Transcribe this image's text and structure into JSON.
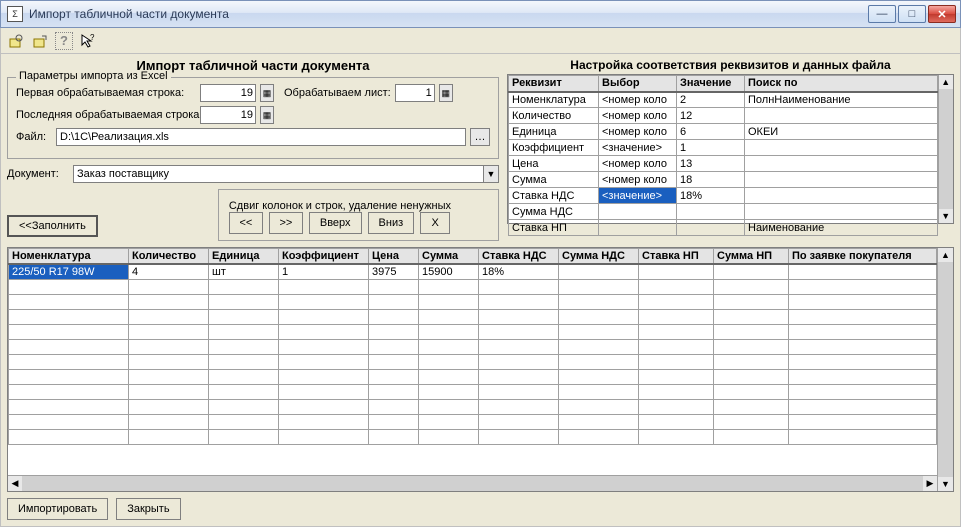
{
  "window": {
    "title": "Импорт табличной части документа"
  },
  "toolbar_icons": [
    "cfg1",
    "cfg2",
    "help",
    "cursor"
  ],
  "left": {
    "title": "Импорт табличной части документа",
    "group_legend": "Параметры импорта из Excel",
    "first_row_label": "Первая обрабатываемая строка:",
    "first_row_value": "19",
    "sheet_label": "Обрабатываем лист:",
    "sheet_value": "1",
    "last_row_label": "Последняя обрабатываемая строка:",
    "last_row_value": "19",
    "file_label": "Файл:",
    "file_value": "D:\\1C\\Реализация.xls",
    "doc_label": "Документ:",
    "doc_value": "Заказ поставщику",
    "shift_legend": "Сдвиг колонок и строк, удаление ненужных",
    "btn_fill": "<<Заполнить",
    "btn_left": "<<",
    "btn_right": ">>",
    "btn_up": "Вверх",
    "btn_down": "Вниз",
    "btn_del": "X"
  },
  "right": {
    "title": "Настройка соответствия реквизитов и данных файла",
    "headers": {
      "c0": "Реквизит",
      "c1": "Выбор",
      "c2": "Значение",
      "c3": "Поиск по"
    },
    "rows": [
      {
        "c0": "Номенклатура",
        "c1": "<номер коло",
        "c2": "2",
        "c3": "ПолнНаименование"
      },
      {
        "c0": "Количество",
        "c1": "<номер коло",
        "c2": "12",
        "c3": ""
      },
      {
        "c0": "Единица",
        "c1": "<номер коло",
        "c2": "6",
        "c3": "ОКЕИ"
      },
      {
        "c0": "Коэффициент",
        "c1": "<значение>",
        "c2": "1",
        "c3": ""
      },
      {
        "c0": "Цена",
        "c1": "<номер коло",
        "c2": "13",
        "c3": ""
      },
      {
        "c0": "Сумма",
        "c1": "<номер коло",
        "c2": "18",
        "c3": ""
      },
      {
        "c0": "Ставка НДС",
        "c1": "<значение>",
        "c2": "18%",
        "c3": "",
        "sel": true
      },
      {
        "c0": "Сумма НДС",
        "c1": "",
        "c2": "",
        "c3": ""
      },
      {
        "c0": "Ставка НП",
        "c1": "",
        "c2": "",
        "c3": "Наименование"
      }
    ]
  },
  "grid": {
    "headers": [
      "Номенклатура",
      "Количество",
      "Единица",
      "Коэффициент",
      "Цена",
      "Сумма",
      "Ставка НДС",
      "Сумма НДС",
      "Ставка НП",
      "Сумма НП",
      "По заявке покупателя"
    ],
    "row0": {
      "c0": "225/50 R17 98W",
      "c1": "4",
      "c2": "шт",
      "c3": "1",
      "c4": "3975",
      "c5": "15900",
      "c6": "18%",
      "c7": "",
      "c8": "",
      "c9": "",
      "c10": ""
    }
  },
  "bottom": {
    "import": "Импортировать",
    "close": "Закрыть"
  }
}
